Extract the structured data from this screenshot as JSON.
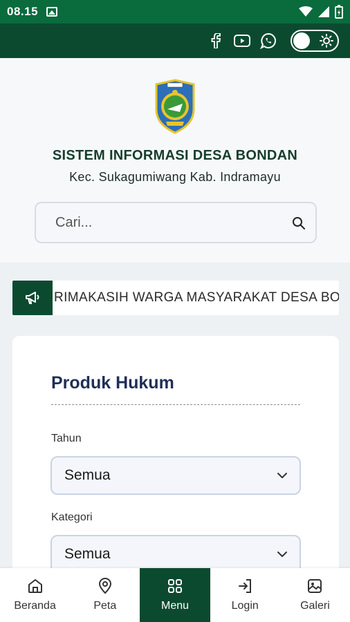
{
  "status_bar": {
    "time": "08.15"
  },
  "site": {
    "title": "SISTEM INFORMASI DESA BONDAN",
    "subtitle": "Kec. Sukagumiwang Kab. Indramayu"
  },
  "search": {
    "placeholder": "Cari..."
  },
  "marquee": {
    "text": "RIMAKASIH WARGA MASYARAKAT DESA BONDAN"
  },
  "card": {
    "title": "Produk Hukum",
    "fields": [
      {
        "label": "Tahun",
        "value": "Semua"
      },
      {
        "label": "Kategori",
        "value": "Semua"
      }
    ]
  },
  "nav": [
    {
      "label": "Beranda",
      "icon": "home-icon"
    },
    {
      "label": "Peta",
      "icon": "map-pin-icon"
    },
    {
      "label": "Menu",
      "icon": "grid-icon"
    },
    {
      "label": "Login",
      "icon": "login-icon"
    },
    {
      "label": "Galeri",
      "icon": "gallery-icon"
    }
  ],
  "colors": {
    "primary": "#0c4a30",
    "status_bar": "#0a6b3d",
    "title": "#1f2f55"
  }
}
